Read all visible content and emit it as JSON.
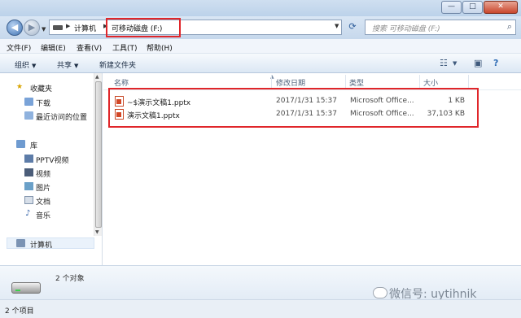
{
  "window": {
    "min_glyph": "—",
    "max_glyph": "□",
    "close_glyph": "✕"
  },
  "nav": {
    "back_glyph": "◀",
    "forward_glyph": "▶"
  },
  "address": {
    "crumbs": [
      "计算机",
      "可移动磁盘 (F:)"
    ],
    "separator": "▶"
  },
  "search": {
    "placeholder": "搜索 可移动磁盘 (F:)"
  },
  "menu": [
    "文件(F)",
    "编辑(E)",
    "查看(V)",
    "工具(T)",
    "帮助(H)"
  ],
  "commands": {
    "organize": "组织",
    "share": "共享",
    "new_folder": "新建文件夹",
    "dropdown_glyph": "▼"
  },
  "sidebar": {
    "favorites": {
      "label": "收藏夹",
      "items": [
        "下载",
        "最近访问的位置"
      ]
    },
    "libraries": {
      "label": "库",
      "items": [
        "PPTV视频",
        "视频",
        "图片",
        "文档",
        "音乐"
      ]
    },
    "computer": {
      "label": "计算机"
    }
  },
  "columns": [
    "名称",
    "修改日期",
    "类型",
    "大小"
  ],
  "files": [
    {
      "name": "~$演示文稿1.pptx",
      "modified": "2017/1/31 15:37",
      "type": "Microsoft Office...",
      "size": "1 KB"
    },
    {
      "name": "演示文稿1.pptx",
      "modified": "2017/1/31 15:37",
      "type": "Microsoft Office...",
      "size": "37,103 KB"
    }
  ],
  "details": {
    "count": "2 个对象"
  },
  "watermark": {
    "text": "微信号: uytihnik"
  },
  "status": {
    "text": "2 个项目"
  },
  "colors": {
    "highlight": "#e0262a",
    "accent": "#3f73b4"
  }
}
